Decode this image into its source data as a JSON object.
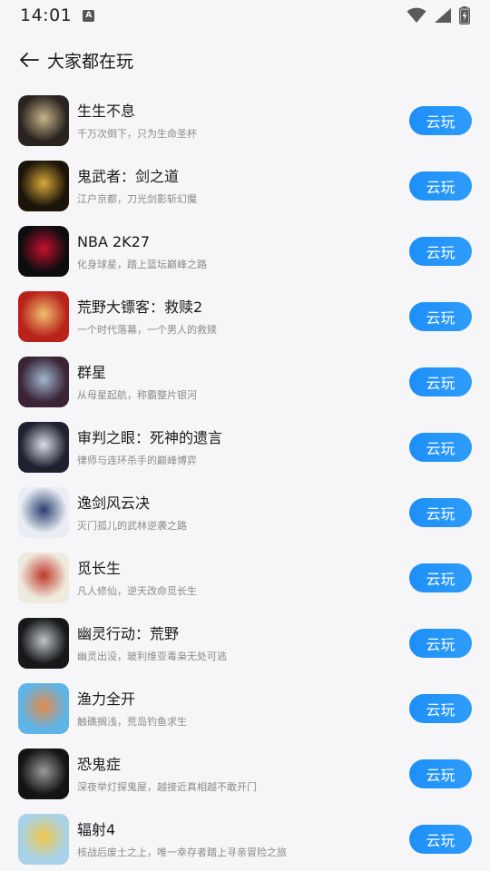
{
  "status_bar": {
    "time": "14:01",
    "notification_glyph": "A",
    "icons": [
      "wifi-icon",
      "signal-icon",
      "battery-charging-icon"
    ]
  },
  "header": {
    "back_icon": "arrow-left-icon",
    "title": "大家都在玩"
  },
  "games": [
    {
      "name": "生生不息",
      "desc": "千万次倒下，只为生命圣杯",
      "button": "云玩",
      "thumb_bg": "#2a2420",
      "thumb_accent": "#c9b48a"
    },
    {
      "name": "鬼武者：剑之道",
      "desc": "江户京都，刀光剑影斩幻魔",
      "button": "云玩",
      "thumb_bg": "#1b1408",
      "thumb_accent": "#d8a93b"
    },
    {
      "name": "NBA 2K27",
      "desc": "化身球星，踏上篮坛巅峰之路",
      "button": "云玩",
      "thumb_bg": "#0d0d10",
      "thumb_accent": "#c8102e"
    },
    {
      "name": "荒野大镖客：救赎2",
      "desc": "一个时代落幕，一个男人的救赎",
      "button": "云玩",
      "thumb_bg": "#b8221a",
      "thumb_accent": "#f0c070"
    },
    {
      "name": "群星",
      "desc": "从母星起航，称霸整片银河",
      "button": "云玩",
      "thumb_bg": "#3a2436",
      "thumb_accent": "#9fb7d0"
    },
    {
      "name": "审判之眼：死神的遗言",
      "desc": "律师与连环杀手的巅峰博弈",
      "button": "云玩",
      "thumb_bg": "#1e2230",
      "thumb_accent": "#d9dde6"
    },
    {
      "name": "逸剑风云决",
      "desc": "灭门孤儿的武林逆袭之路",
      "button": "云玩",
      "thumb_bg": "#e9eef4",
      "thumb_accent": "#2b3e6e"
    },
    {
      "name": "觅长生",
      "desc": "凡人修仙，逆天改命觅长生",
      "button": "云玩",
      "thumb_bg": "#eeeadd",
      "thumb_accent": "#c0392b"
    },
    {
      "name": "幽灵行动：荒野",
      "desc": "幽灵出没，玻利维亚毒枭无处可逃",
      "button": "云玩",
      "thumb_bg": "#16181a",
      "thumb_accent": "#bfc3c7"
    },
    {
      "name": "渔力全开",
      "desc": "触礁搁浅，荒岛钓鱼求生",
      "button": "云玩",
      "thumb_bg": "#5fb4e6",
      "thumb_accent": "#e58a4a"
    },
    {
      "name": "恐鬼症",
      "desc": "深夜举灯探鬼屋，越接近真相越不敢开门",
      "button": "云玩",
      "thumb_bg": "#141414",
      "thumb_accent": "#9a9a9a"
    },
    {
      "name": "辐射4",
      "desc": "核战后废土之上，唯一幸存者踏上寻亲冒险之旅",
      "button": "云玩",
      "thumb_bg": "#a8d2e8",
      "thumb_accent": "#f2c94c"
    }
  ]
}
